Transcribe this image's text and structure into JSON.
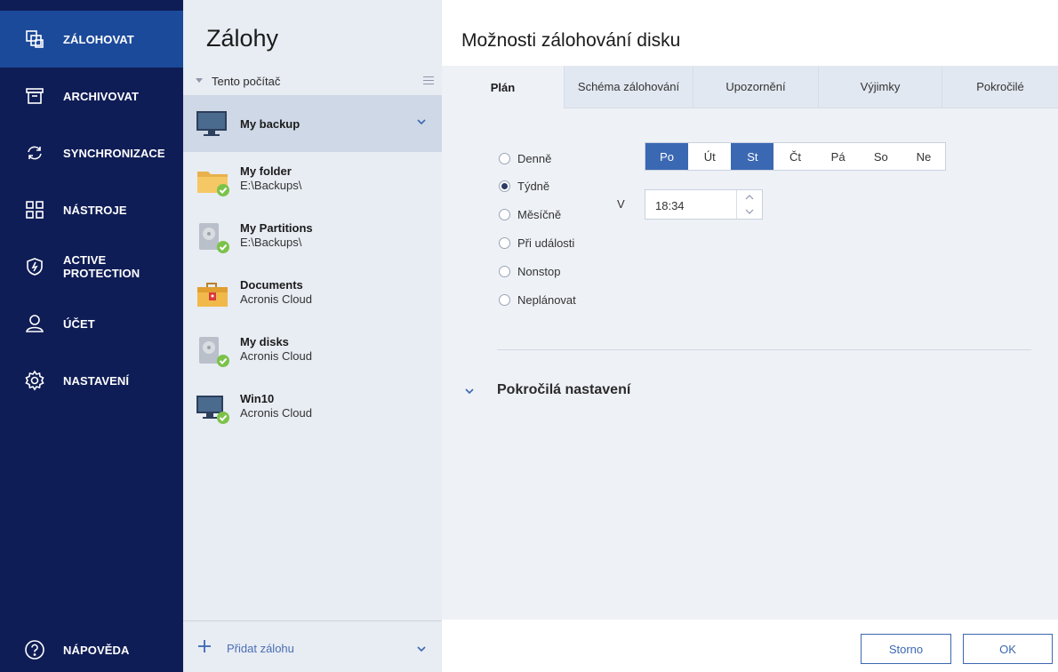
{
  "nav": {
    "items": [
      {
        "label": "ZÁLOHOVAT",
        "icon": "backup-copy-icon"
      },
      {
        "label": "ARCHIVOVAT",
        "icon": "archive-box-icon"
      },
      {
        "label": "SYNCHRONIZACE",
        "icon": "sync-icon"
      },
      {
        "label": "NÁSTROJE",
        "icon": "tools-grid-icon"
      },
      {
        "label": "ACTIVE PROTECTION",
        "icon": "shield-lightning-icon"
      },
      {
        "label": "ÚČET",
        "icon": "user-icon"
      },
      {
        "label": "NASTAVENÍ",
        "icon": "gear-icon"
      }
    ],
    "help": {
      "label": "NÁPOVĚDA",
      "icon": "help-circle-icon"
    }
  },
  "backups": {
    "title": "Zálohy",
    "group": "Tento počítač",
    "items": [
      {
        "name": "My backup",
        "sub": ""
      },
      {
        "name": "My folder",
        "sub": "E:\\Backups\\"
      },
      {
        "name": "My Partitions",
        "sub": "E:\\Backups\\"
      },
      {
        "name": "Documents",
        "sub": "Acronis Cloud"
      },
      {
        "name": "My disks",
        "sub": "Acronis Cloud"
      },
      {
        "name": "Win10",
        "sub": "Acronis Cloud"
      }
    ],
    "add_label": "Přidat zálohu"
  },
  "panel": {
    "title": "Možnosti zálohování disku",
    "tabs": [
      "Plán",
      "Schéma zálohování",
      "Upozornění",
      "Výjimky",
      "Pokročilé"
    ],
    "schedule": {
      "options": [
        "Denně",
        "Týdně",
        "Měsíčně",
        "Při události",
        "Nonstop",
        "Neplánovat"
      ],
      "selected": "Týdně",
      "days": [
        "Po",
        "Út",
        "St",
        "Čt",
        "Pá",
        "So",
        "Ne"
      ],
      "selected_days": [
        "Po",
        "St"
      ],
      "time_label": "V",
      "time": "18:34"
    },
    "advanced_label": "Pokročilá nastavení",
    "cancel_label": "Storno",
    "ok_label": "OK"
  },
  "colors": {
    "nav_bg": "#0f1d56",
    "nav_active": "#1c4a9a",
    "accent": "#3b68b2",
    "list_bg": "#e8ecf3",
    "status_ok": "#7cc24a"
  }
}
